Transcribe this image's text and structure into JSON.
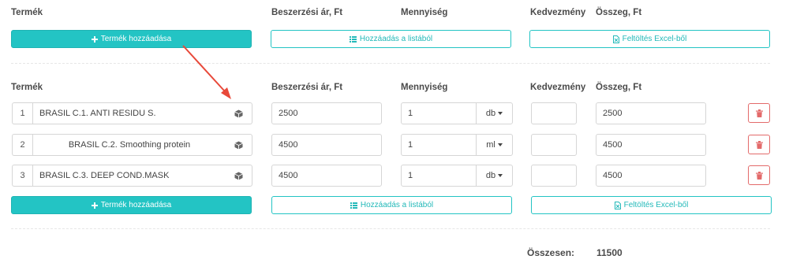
{
  "headers": {
    "product": "Termék",
    "price": "Beszerzési ár, Ft",
    "quantity": "Mennyiség",
    "discount": "Kedvezmény",
    "sum": "Összeg, Ft"
  },
  "actions": {
    "add_product": "Termék hozzáadása",
    "add_from_list": "Hozzáadás a listából",
    "upload_excel": "Feltöltés Excel-ből"
  },
  "rows": [
    {
      "num": "1",
      "name": "BRASIL C.1. ANTI RESIDU S.",
      "price": "2500",
      "qty": "1",
      "unit": "db",
      "discount": "",
      "sum": "2500"
    },
    {
      "num": "2",
      "name": "BRASIL C.2. Smoothing protein",
      "price": "4500",
      "qty": "1",
      "unit": "ml",
      "discount": "",
      "sum": "4500"
    },
    {
      "num": "3",
      "name": "BRASIL C.3. DEEP COND.MASK",
      "price": "4500",
      "qty": "1",
      "unit": "db",
      "discount": "",
      "sum": "4500"
    }
  ],
  "total": {
    "label": "Összesen:",
    "value": "11500"
  },
  "colors": {
    "accent": "#23c4c4",
    "danger": "#e36a6a",
    "arrow": "#e8493a"
  },
  "icons": [
    "plus-icon",
    "list-icon",
    "excel-file-icon",
    "box-icon",
    "trash-icon",
    "chevron-down-icon"
  ]
}
